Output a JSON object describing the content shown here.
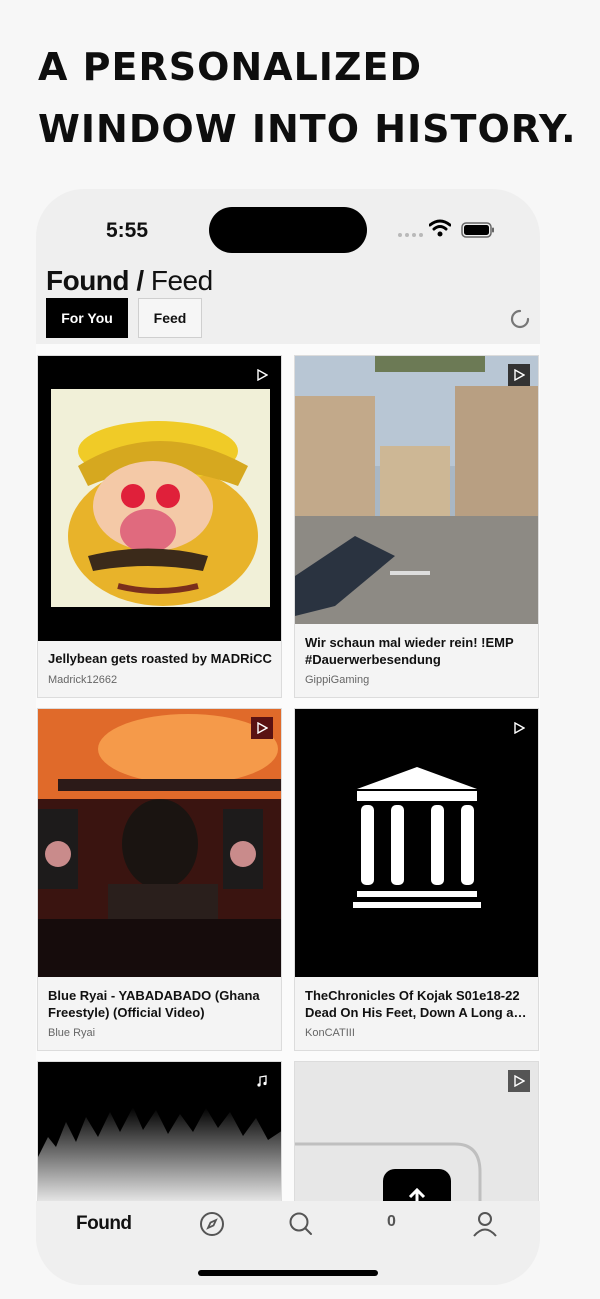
{
  "headline": "A personalized window into history.",
  "status_bar": {
    "time": "5:55"
  },
  "header": {
    "title_bold": "Found",
    "title_separator": "/",
    "title_light": "Feed"
  },
  "tabs": [
    {
      "label": "For You",
      "active": true
    },
    {
      "label": "Feed",
      "active": false
    }
  ],
  "cards": [
    {
      "title": "Jellybean gets roasted by MADRiCC",
      "author": "Madrick12662",
      "media": "video"
    },
    {
      "title": "Wir schaun mal wieder rein! !EMP #Dauerwerbesendung",
      "author": "GippiGaming",
      "media": "video"
    },
    {
      "title": "Blue Ryai - YABADABADO (Ghana Freestyle) (Official Video)",
      "author": "Blue Ryai",
      "media": "video"
    },
    {
      "title": "TheChronicles Of Kojak S01e18-22 Dead On His Feet, Down A Long a…",
      "author": "KonCATIII",
      "media": "video"
    },
    {
      "title": "",
      "author": "",
      "media": "audio"
    },
    {
      "title": "",
      "author": "",
      "media": "video"
    }
  ],
  "bottom_nav": {
    "found_label": "Found",
    "count": "0"
  },
  "icons": [
    "wifi-icon",
    "battery-icon",
    "refresh-icon",
    "play-icon",
    "music-note-icon",
    "compass-icon",
    "search-icon",
    "profile-icon",
    "museum-icon"
  ],
  "colors": {
    "background": "#f7f7f7",
    "phone": "#efefef",
    "accent": "#000000"
  }
}
